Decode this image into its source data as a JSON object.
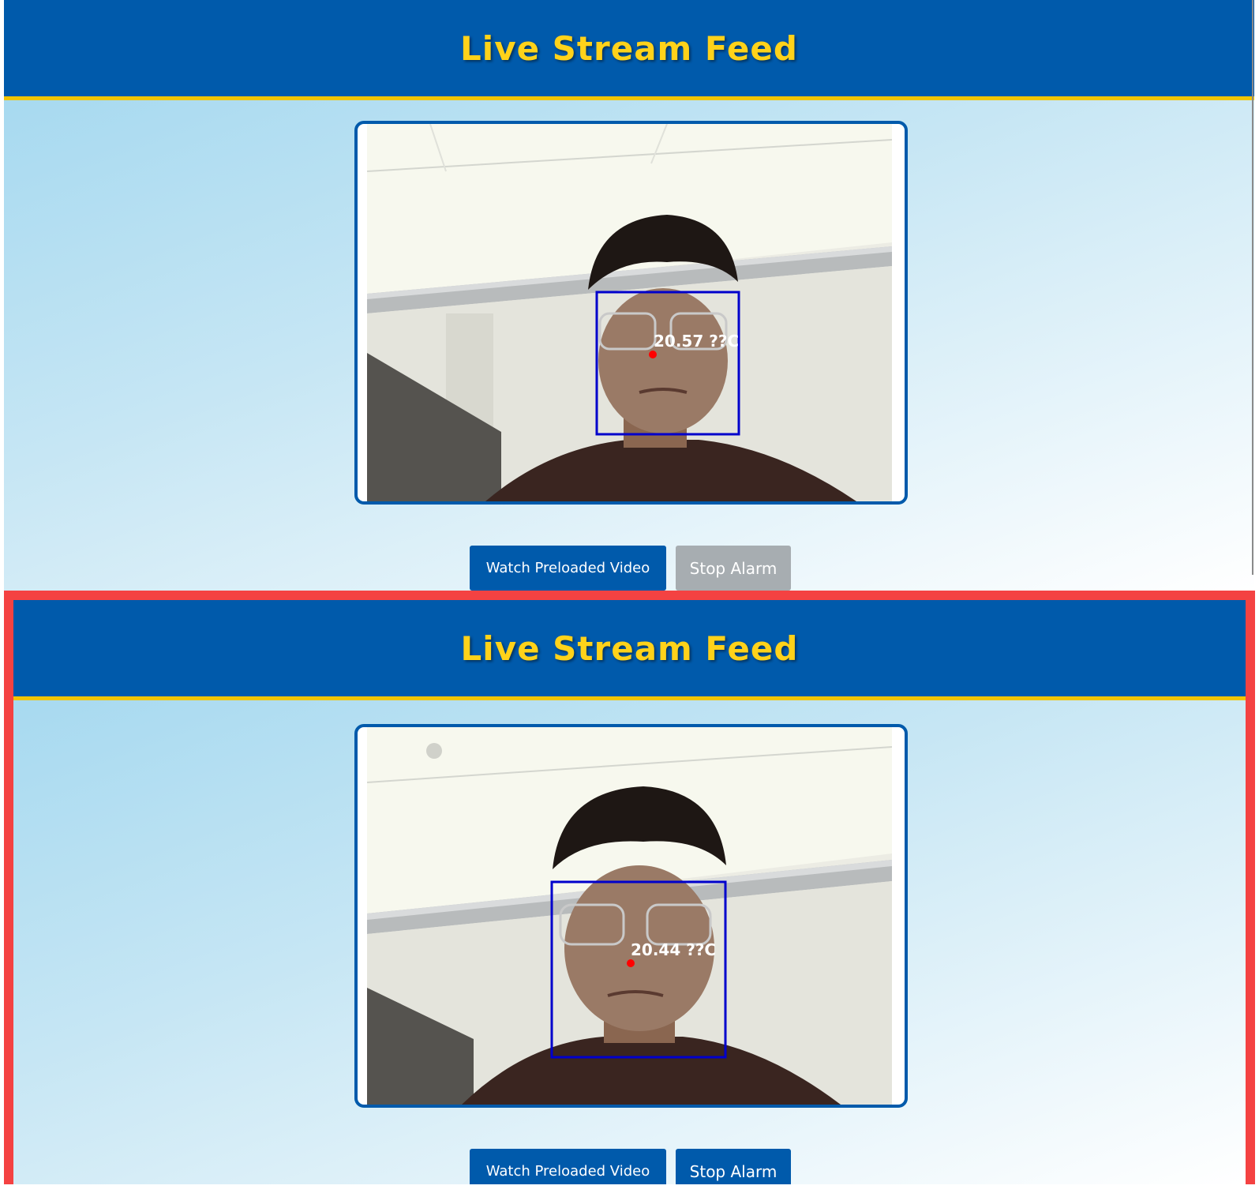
{
  "header": {
    "title": "Live Stream Feed"
  },
  "buttons": {
    "watch_label": "Watch Preloaded Video",
    "stop_label": "Stop Alarm"
  },
  "frames": [
    {
      "temperature_label": "20.57 ??C",
      "stop_alarm_state": "disabled"
    },
    {
      "temperature_label": "20.44 ??C",
      "stop_alarm_state": "enabled"
    }
  ],
  "colors": {
    "header_bg": "#005aab",
    "title_text": "#ffd21a",
    "header_underline": "#f2c500",
    "button_primary": "#005aab",
    "button_disabled": "#a7adb1",
    "alert_border": "#f44242",
    "face_box": "#0000cc",
    "temperature_point": "#ff0000"
  },
  "icons": {
    "face_box": "face-detection-box",
    "measurement_point": "temperature-point-dot"
  }
}
